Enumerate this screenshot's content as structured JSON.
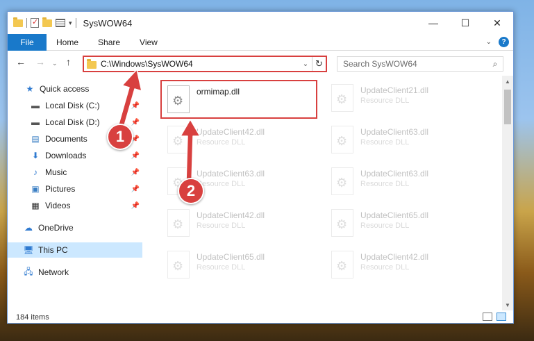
{
  "window": {
    "title": "SysWOW64",
    "controls": {
      "minimize": "—",
      "maximize": "☐",
      "close": "✕"
    }
  },
  "ribbon": {
    "tabs": [
      "File",
      "Home",
      "Share",
      "View"
    ],
    "help": "?"
  },
  "navbar": {
    "address": "C:\\Windows\\SysWOW64",
    "search_placeholder": "Search SysWOW64"
  },
  "navpane": {
    "quick_access": "Quick access",
    "items": [
      {
        "label": "Local Disk (C:)",
        "icon": "drive-icon"
      },
      {
        "label": "Local Disk (D:)",
        "icon": "drive-icon"
      },
      {
        "label": "Documents",
        "icon": "documents-icon"
      },
      {
        "label": "Downloads",
        "icon": "downloads-icon"
      },
      {
        "label": "Music",
        "icon": "music-icon"
      },
      {
        "label": "Pictures",
        "icon": "pictures-icon"
      },
      {
        "label": "Videos",
        "icon": "videos-icon"
      }
    ],
    "onedrive": "OneDrive",
    "this_pc": "This PC",
    "network": "Network"
  },
  "files": [
    {
      "name": "ormimap.dll",
      "type": ""
    },
    {
      "name": "UpdateClient21.dll",
      "type": "Resource DLL"
    },
    {
      "name": "UpdateClient42.dll",
      "type": "Resource DLL"
    },
    {
      "name": "UpdateClient63.dll",
      "type": "Resource DLL"
    },
    {
      "name": "UpdateClient63.dll",
      "type": "Resource DLL"
    },
    {
      "name": "UpdateClient63.dll",
      "type": "Resource DLL"
    },
    {
      "name": "UpdateClient42.dll",
      "type": "Resource DLL"
    },
    {
      "name": "UpdateClient65.dll",
      "type": "Resource DLL"
    },
    {
      "name": "UpdateClient65.dll",
      "type": "Resource DLL"
    },
    {
      "name": "UpdateClient42.dll",
      "type": "Resource DLL"
    }
  ],
  "status": {
    "count": "184 items"
  },
  "annotations": {
    "badge1": "1",
    "badge2": "2"
  },
  "colors": {
    "accent": "#1979ca",
    "highlight": "#d8403f",
    "selected": "#cce8ff"
  }
}
